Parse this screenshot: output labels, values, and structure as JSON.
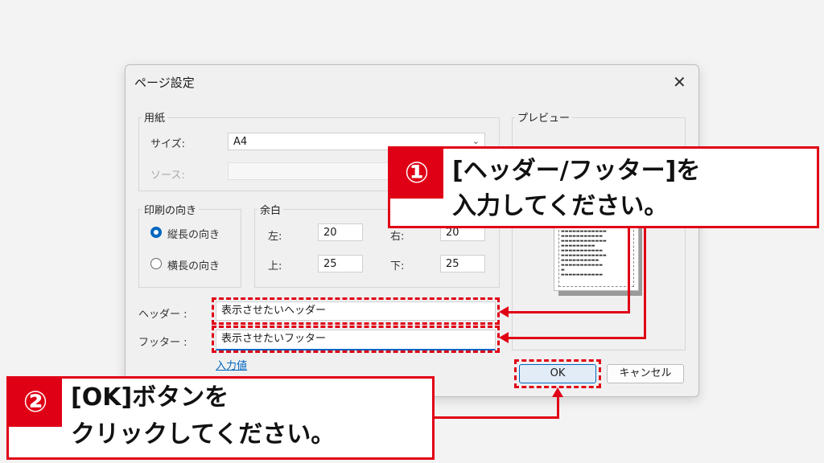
{
  "dialog": {
    "title": "ページ設定",
    "close_icon": "close-icon",
    "paper": {
      "group_label": "用紙",
      "size_label": "サイズ:",
      "size_value": "A4",
      "source_label": "ソース:",
      "source_value": ""
    },
    "orientation": {
      "group_label": "印刷の向き",
      "portrait": "縦長の向き",
      "landscape": "横長の向き",
      "selected": "portrait"
    },
    "margins": {
      "group_label": "余白",
      "left_label": "左:",
      "left_value": "20",
      "right_label": "右:",
      "right_value": "20",
      "top_label": "上:",
      "top_value": "25",
      "bottom_label": "下:",
      "bottom_value": "25"
    },
    "header_label": "ヘッダー :",
    "header_value": "表示させたいヘッダー",
    "footer_label": "フッター :",
    "footer_value": "表示させたいフッター",
    "input_values_link": "入力値",
    "preview": {
      "group_label": "プレビュー"
    },
    "ok_label": "OK",
    "cancel_label": "キャンセル"
  },
  "annotations": {
    "step1": {
      "number": "①",
      "line1": "[ヘッダー/フッター]を",
      "line2": "入力してください。"
    },
    "step2": {
      "number": "②",
      "line1": "[OK]ボタンを",
      "line2": "クリックしてください。"
    },
    "accent_color": "#e00016"
  }
}
